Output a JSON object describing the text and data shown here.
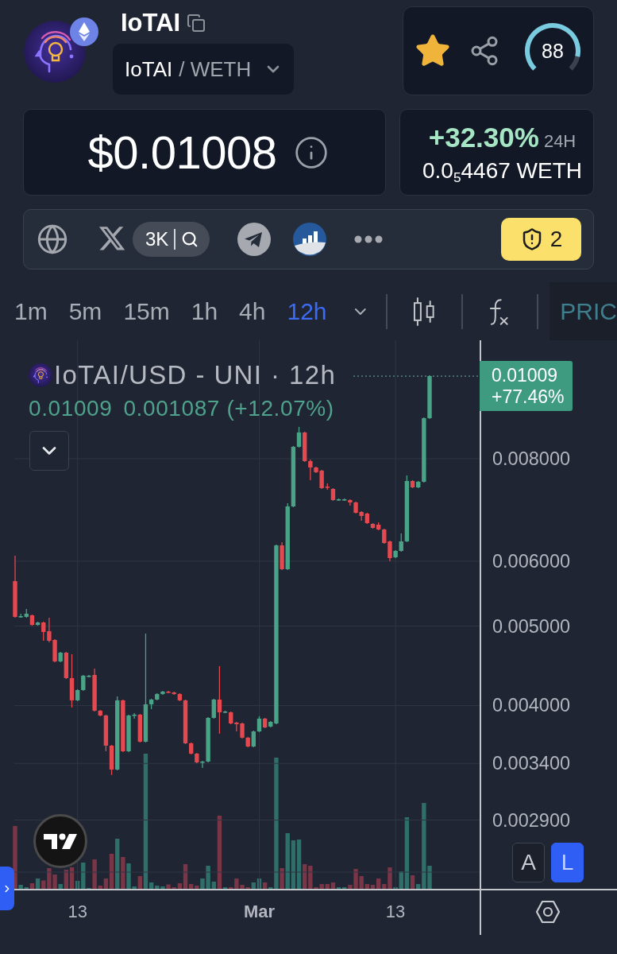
{
  "token": {
    "name": "IoTAI",
    "pair": {
      "base": "IoTAI",
      "quote": "/ WETH"
    }
  },
  "actions": {
    "favorite": true,
    "score": {
      "value": "88",
      "level": 0.88
    }
  },
  "price": {
    "value": "$0.01008"
  },
  "change": {
    "percent": "+32.30%",
    "period": "24H",
    "native_price": "0.0$_{5}$4467 WETH"
  },
  "links": {
    "x_followers": "3K",
    "alerts": "2"
  },
  "timeframes": [
    {
      "label": "1m",
      "selected": false
    },
    {
      "label": "5m",
      "selected": false
    },
    {
      "label": "15m",
      "selected": false
    },
    {
      "label": "1h",
      "selected": false
    },
    {
      "label": "4h",
      "selected": false
    },
    {
      "label": "12h",
      "selected": true
    }
  ],
  "toolbar": {
    "cut_tab": "PRIC"
  },
  "chart": {
    "legend": {
      "last": "0.01009",
      "change": "0.001087 (+12.07%)"
    },
    "price_tag": {
      "price": "0.01009",
      "change": "+77.46%"
    },
    "chart_data": {
      "type": "candlestick",
      "title": "IoTAI/USD - UNI · 12h",
      "log": true,
      "grid": true,
      "categories": [
        null,
        null,
        null,
        null,
        null,
        null,
        null,
        null,
        null,
        null,
        null,
        "13",
        null,
        null,
        null,
        null,
        null,
        null,
        null,
        null,
        null,
        null,
        null,
        null,
        null,
        null,
        null,
        null,
        null,
        null,
        null,
        null,
        null,
        null,
        null,
        null,
        null,
        null,
        null,
        null,
        null,
        null,
        null,
        "**Mar**",
        null,
        null,
        null,
        null,
        null,
        null,
        null,
        null,
        null,
        null,
        null,
        null,
        null,
        null,
        null,
        null,
        null,
        null,
        null,
        null,
        null,
        null,
        null,
        "13",
        null,
        null,
        null,
        null,
        null,
        null
      ],
      "ohlc": [
        [
          0.005673,
          0.006093,
          0.005119,
          0.005131
        ],
        [
          0.005131,
          0.005177,
          0.005119,
          0.005142
        ],
        [
          0.005131,
          0.005247,
          0.005119,
          0.005177
        ],
        [
          0.005154,
          0.005165,
          0.005006,
          0.005017
        ],
        [
          0.005017,
          0.005062,
          0.005006,
          0.005051
        ],
        [
          0.005051,
          0.005062,
          0.004798,
          0.004918
        ],
        [
          0.004929,
          0.005119,
          0.004777,
          0.004798
        ],
        [
          0.004809,
          0.00482,
          0.004518,
          0.004528
        ],
        [
          0.004528,
          0.004651,
          0.004518,
          0.00464
        ],
        [
          0.00464,
          0.004651,
          0.004311,
          0.004321
        ],
        [
          0.004321,
          0.00462,
          0.003978,
          0.004059
        ],
        [
          0.004059,
          0.004188,
          0.00405,
          0.004178
        ],
        [
          0.004178,
          0.004359,
          0.004169,
          0.00435
        ],
        [
          0.00434,
          0.004359,
          0.00433,
          0.00435
        ],
        [
          0.004359,
          0.004438,
          0.003934,
          0.003943
        ],
        [
          0.003943,
          0.003951,
          0.003882,
          0.00389
        ],
        [
          0.00389,
          0.003899,
          0.003518,
          0.003574
        ],
        [
          0.003574,
          0.003582,
          0.003291,
          0.003342
        ],
        [
          0.003342,
          0.004104,
          0.003335,
          0.004059
        ],
        [
          0.004059,
          0.004068,
          0.003511,
          0.003518
        ],
        [
          0.003518,
          0.003899,
          0.003511,
          0.00389
        ],
        [
          0.00389,
          0.003916,
          0.003856,
          0.003899
        ],
        [
          0.003899,
          0.003908,
          0.003606,
          0.003614
        ],
        [
          0.003614,
          0.004896,
          0.003606,
          0.004014
        ],
        [
          0.004014,
          0.004077,
          0.00396,
          0.004068
        ],
        [
          0.004068,
          0.004141,
          0.004059,
          0.004132
        ],
        [
          0.004132,
          0.004169,
          0.004123,
          0.00416
        ],
        [
          0.00416,
          0.004169,
          0.004141,
          0.00415
        ],
        [
          0.00415,
          0.00416,
          0.004123,
          0.004132
        ],
        [
          0.004132,
          0.004141,
          0.00405,
          0.004059
        ],
        [
          0.004059,
          0.004068,
          0.00359,
          0.003598
        ],
        [
          0.003598,
          0.003606,
          0.003487,
          0.003495
        ],
        [
          0.003495,
          0.003503,
          0.003403,
          0.00341
        ],
        [
          0.00341,
          0.003425,
          0.003357,
          0.003418
        ],
        [
          0.003418,
          0.003873,
          0.00341,
          0.003864
        ],
        [
          0.003864,
          0.004077,
          0.003856,
          0.004068
        ],
        [
          0.004068,
          0.004468,
          0.003696,
          0.003925
        ],
        [
          0.003925,
          0.003943,
          0.003916,
          0.003934
        ],
        [
          0.003925,
          0.003934,
          0.003796,
          0.003804
        ],
        [
          0.003813,
          0.003821,
          0.00372,
          0.003796
        ],
        [
          0.003804,
          0.003813,
          0.003646,
          0.003655
        ],
        [
          0.003655,
          0.003663,
          0.003558,
          0.003566
        ],
        [
          0.003566,
          0.003729,
          0.003558,
          0.00372
        ],
        [
          0.00372,
          0.003882,
          0.003712,
          0.003856
        ],
        [
          0.003856,
          0.003864,
          0.003754,
          0.003762
        ],
        [
          0.003771,
          0.00383,
          0.003762,
          0.003821
        ],
        [
          0.003804,
          0.006286,
          0.003796,
          0.006272
        ],
        [
          0.006272,
          0.006329,
          0.005853,
          0.005866
        ],
        [
          0.005866,
          0.00706,
          0.005853,
          0.006997
        ],
        [
          0.006997,
          0.008291,
          0.006982,
          0.008272
        ],
        [
          0.008272,
          0.008747,
          0.008254,
          0.008612
        ],
        [
          0.008612,
          0.008631,
          0.007929,
          0.007947
        ],
        [
          0.007947,
          0.007982,
          0.007532,
          0.007806
        ],
        [
          0.007806,
          0.007823,
          0.007685,
          0.007702
        ],
        [
          0.007737,
          0.007754,
          0.007349,
          0.007366
        ],
        [
          0.007399,
          0.007465,
          0.007333,
          0.007382
        ],
        [
          0.007349,
          0.007366,
          0.007107,
          0.007123
        ],
        [
          0.007123,
          0.007155,
          0.007107,
          0.007139
        ],
        [
          0.007123,
          0.007155,
          0.007107,
          0.007139
        ],
        [
          0.007123,
          0.007139,
          0.007013,
          0.007076
        ],
        [
          0.007076,
          0.007092,
          0.006858,
          0.006873
        ],
        [
          0.006889,
          0.006904,
          0.006722,
          0.006812
        ],
        [
          0.006858,
          0.006873,
          0.006662,
          0.006677
        ],
        [
          0.006662,
          0.006677,
          0.006573,
          0.006588
        ],
        [
          0.006647,
          0.006692,
          0.006544,
          0.006559
        ],
        [
          0.006559,
          0.006573,
          0.0063,
          0.006314
        ],
        [
          0.006343,
          0.006357,
          0.005998,
          0.006052
        ],
        [
          0.006066,
          0.006189,
          0.006052,
          0.006175
        ],
        [
          0.006175,
          0.006486,
          0.006161,
          0.006343
        ],
        [
          0.006343,
          0.007634,
          0.006329,
          0.007515
        ],
        [
          0.007515,
          0.007532,
          0.007366,
          0.007382
        ],
        [
          0.007382,
          0.007515,
          0.007366,
          0.007499
        ],
        [
          0.007499,
          0.008985,
          0.007482,
          0.008965
        ],
        [
          0.008965,
          0.01011,
          0.008945,
          0.01009
        ]
      ],
      "ylim": [
        0.002391,
        0.011157
      ],
      "yticks": [
        {
          "value": 0.008,
          "label": "0.008000"
        },
        {
          "value": 0.006,
          "label": "0.006000"
        },
        {
          "value": 0.005,
          "label": "0.005000"
        },
        {
          "value": 0.004,
          "label": "0.004000"
        },
        {
          "value": 0.0034,
          "label": "0.003400"
        },
        {
          "value": 0.0029,
          "label": "0.002900"
        }
      ]
    },
    "scale_buttons": [
      {
        "label": "A",
        "selected": false
      },
      {
        "label": "L",
        "selected": true
      }
    ]
  }
}
